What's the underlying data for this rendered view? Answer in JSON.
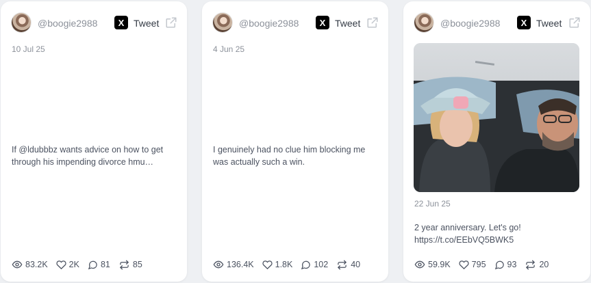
{
  "cards": [
    {
      "handle": "@boogie2988",
      "tweet_label": "Tweet",
      "date": "10 Jul 25",
      "text": "If @ldubbbz wants advice on how to get through his impending divorce hmu…",
      "views": "83.2K",
      "likes": "2K",
      "replies": "81",
      "retweets": "85"
    },
    {
      "handle": "@boogie2988",
      "tweet_label": "Tweet",
      "date": "4 Jun 25",
      "text": "I genuinely had no clue him blocking me was actually such a win.",
      "views": "136.4K",
      "likes": "1.8K",
      "replies": "102",
      "retweets": "40"
    },
    {
      "handle": "@boogie2988",
      "tweet_label": "Tweet",
      "date": "22 Jun 25",
      "text": "2 year anniversary. Let's go! https://t.co/EEbVQ5BWK5",
      "views": "59.9K",
      "likes": "795",
      "replies": "93",
      "retweets": "20"
    }
  ],
  "icons": {
    "platform": "x-logo-icon",
    "open": "external-link-icon",
    "views": "eye-icon",
    "likes": "heart-icon",
    "replies": "comment-icon",
    "retweets": "retweet-icon"
  }
}
